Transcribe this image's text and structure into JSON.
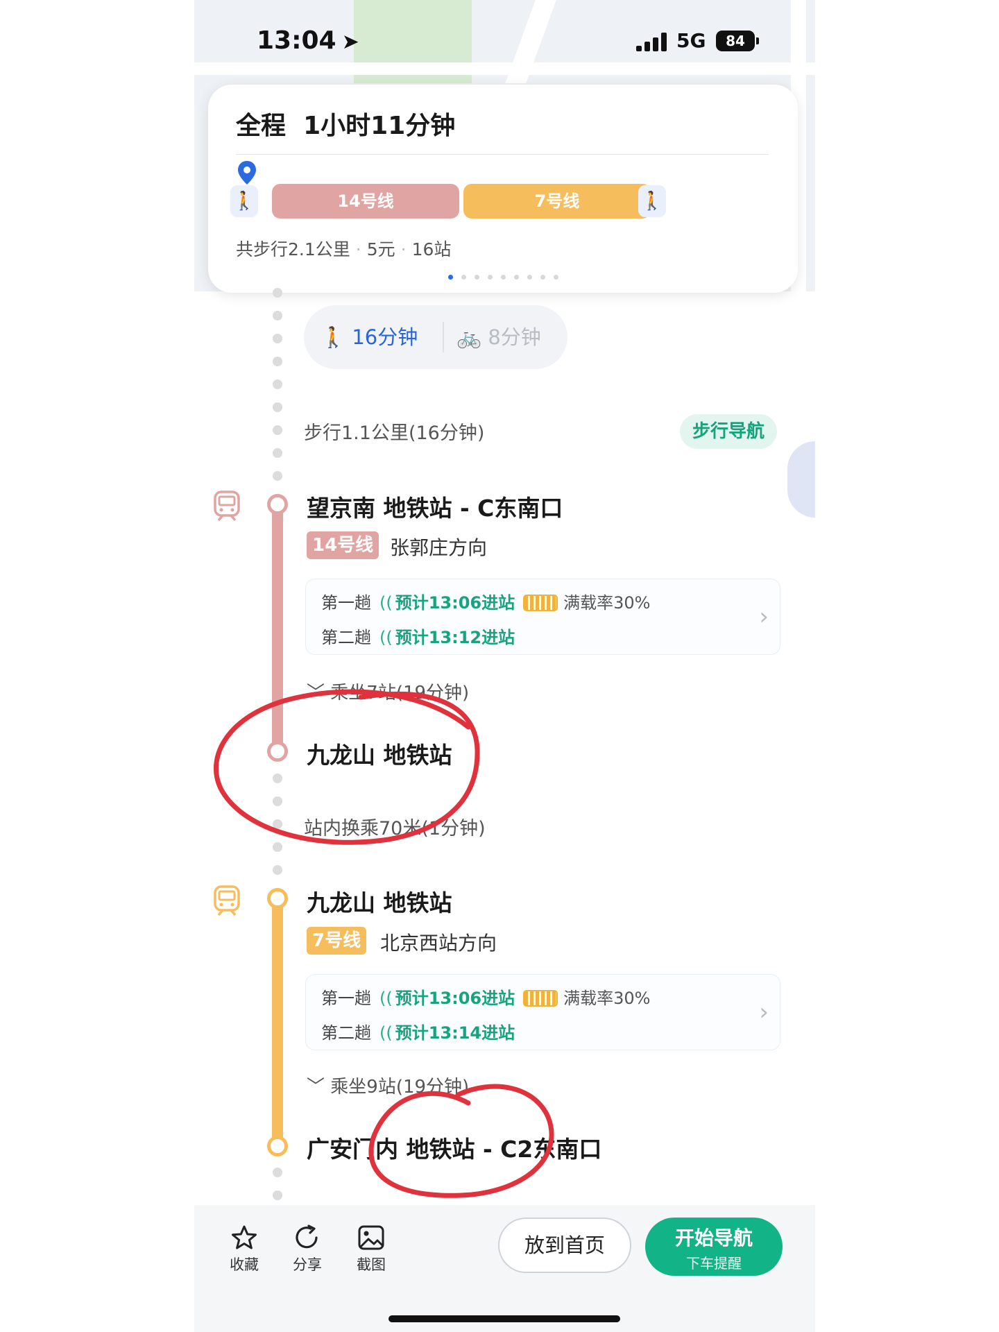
{
  "status_bar": {
    "time": "13:04",
    "network": "5G",
    "battery": "84"
  },
  "summary": {
    "total_label": "全程",
    "duration": "1小时11分钟",
    "segments": [
      {
        "label": "14号线",
        "color": "#e0a4a2"
      },
      {
        "label": "7号线",
        "color": "#f6bd5c"
      }
    ],
    "walk_total": "共步行2.1公里",
    "fare": "5元",
    "stops": "16站",
    "page_count": 9,
    "page_active": 1
  },
  "modes": {
    "walk": "16分钟",
    "bike": "8分钟"
  },
  "walk_leg": {
    "text": "步行1.1公里(16分钟)",
    "nav_label": "步行导航"
  },
  "leg1": {
    "board_station": "望京南 地铁站 - C东南口",
    "line": "14号线",
    "line_color": "#e0a4a2",
    "direction": "张郭庄方向",
    "trains": [
      {
        "label": "第一趟",
        "eta": "预计13:06进站",
        "load": "满载率30%"
      },
      {
        "label": "第二趟",
        "eta": "预计13:12进站"
      }
    ],
    "ride": "乘坐7站(19分钟)",
    "alight_station": "九龙山 地铁站"
  },
  "transfer": {
    "text": "站内换乘70米(1分钟)"
  },
  "leg2": {
    "board_station": "九龙山 地铁站",
    "line": "7号线",
    "line_color": "#f6bd5c",
    "direction": "北京西站方向",
    "trains": [
      {
        "label": "第一趟",
        "eta": "预计13:06进站",
        "load": "满载率30%"
      },
      {
        "label": "第二趟",
        "eta": "预计13:14进站"
      }
    ],
    "ride": "乘坐9站(19分钟)",
    "alight_station": "广安门内 地铁站 - C2东南口"
  },
  "bottom_bar": {
    "favorite": "收藏",
    "share": "分享",
    "screenshot": "截图",
    "home_button": "放到首页",
    "start_nav": "开始导航",
    "start_nav_sub": "下车提醒"
  },
  "colors": {
    "accent_green": "#12b487",
    "walk_blue": "#2866d8",
    "annotation_red": "#e0323c"
  }
}
